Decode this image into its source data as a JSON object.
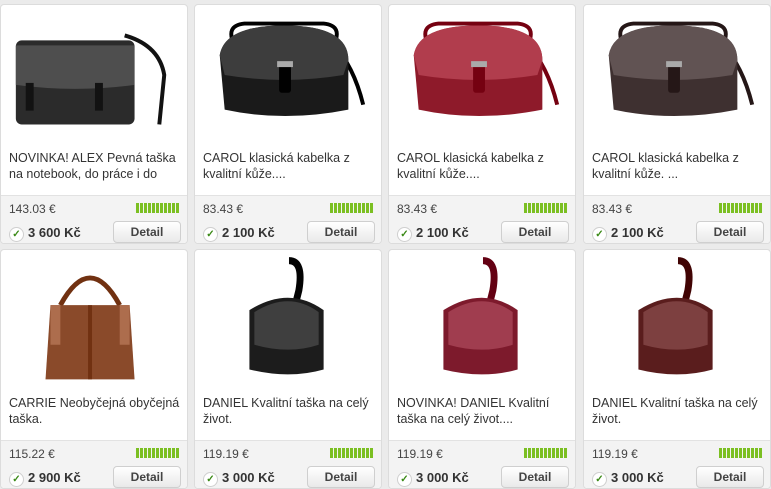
{
  "colors": {
    "stock_bar": "#7bbf22",
    "check": "#3b8a17",
    "page_bg": "#ebebeb"
  },
  "products": [
    {
      "title": "NOVINKA! ALEX Pevná taška na notebook, do práce i do",
      "price_eur": "143.03 €",
      "price_czk": "3 600 Kč",
      "detail_label": "Detail",
      "bag_color": "#2b2b2b",
      "bag_type": "messenger",
      "in_stock_icon": "check-icon"
    },
    {
      "title": "CAROL klasická kabelka z kvalitní kůže....",
      "price_eur": "83.43 €",
      "price_czk": "2 100 Kč",
      "detail_label": "Detail",
      "bag_color": "#1a1a1a",
      "bag_type": "saddle",
      "in_stock_icon": "check-icon"
    },
    {
      "title": "CAROL klasická kabelka z kvalitní kůže....",
      "price_eur": "83.43 €",
      "price_czk": "2 100 Kč",
      "detail_label": "Detail",
      "bag_color": "#8e1a2a",
      "bag_type": "saddle",
      "in_stock_icon": "check-icon"
    },
    {
      "title": "CAROL klasická kabelka z kvalitní kůže. ...",
      "price_eur": "83.43 €",
      "price_czk": "2 100 Kč",
      "detail_label": "Detail",
      "bag_color": "#3e3030",
      "bag_type": "saddle",
      "in_stock_icon": "check-icon"
    },
    {
      "title": "CARRIE Neobyčejná obyčejná taška.",
      "price_eur": "115.22 €",
      "price_czk": "2 900 Kč",
      "detail_label": "Detail",
      "bag_color": "#8a4a2a",
      "bag_type": "tote",
      "in_stock_icon": "check-icon"
    },
    {
      "title": "DANIEL Kvalitní taška na celý život.",
      "price_eur": "119.19 €",
      "price_czk": "3 000 Kč",
      "detail_label": "Detail",
      "bag_color": "#1c1c1c",
      "bag_type": "sling",
      "in_stock_icon": "check-icon"
    },
    {
      "title": "NOVINKA! DANIEL Kvalitní taška na celý život....",
      "price_eur": "119.19 €",
      "price_czk": "3 000 Kč",
      "detail_label": "Detail",
      "bag_color": "#7d1a2c",
      "bag_type": "sling",
      "in_stock_icon": "check-icon"
    },
    {
      "title": "DANIEL Kvalitní taška na celý život.",
      "price_eur": "119.19 €",
      "price_czk": "3 000 Kč",
      "detail_label": "Detail",
      "bag_color": "#5a1d1d",
      "bag_type": "sling",
      "in_stock_icon": "check-icon"
    }
  ]
}
